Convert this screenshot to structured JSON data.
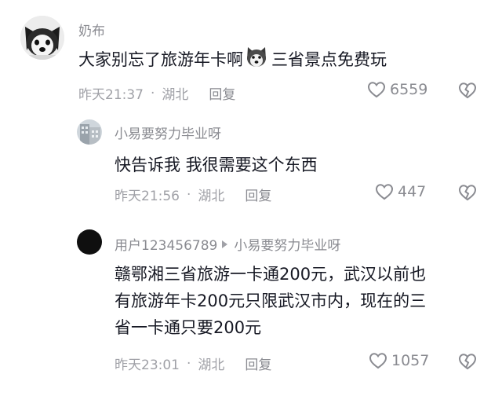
{
  "comments": [
    {
      "author": "奶布",
      "text_before_emoji": "大家别忘了旅游年卡啊",
      "emoji": "husky-emoji",
      "text_after_emoji": "三省景点免费玩",
      "time": "昨天21:37",
      "dot": "·",
      "location": "湖北",
      "reply_label": "回复",
      "likes": "6559"
    },
    {
      "author": "小易要努力毕业呀",
      "text": "快告诉我 我很需要这个东西",
      "time": "昨天21:56",
      "dot": "·",
      "location": "湖北",
      "reply_label": "回复",
      "likes": "447"
    },
    {
      "author": "用户123456789",
      "reply_to": "小易要努力毕业呀",
      "text_lines": [
        "赣鄂湘三省旅游一卡通200元，武汉以前也",
        "有旅游年卡200元只限武汉市内，现在的三",
        "省一卡通只要200元"
      ],
      "time": "昨天23:01",
      "dot": "·",
      "location": "湖北",
      "reply_label": "回复",
      "likes": "1057"
    }
  ],
  "icons": {
    "like": "heart-outline-icon",
    "dislike": "broken-heart-icon",
    "reply_arrow": "play-triangle-icon"
  },
  "colors": {
    "primary_text": "#161823",
    "secondary_text": "#8a8b91",
    "meta_text": "#a0a1a7"
  }
}
